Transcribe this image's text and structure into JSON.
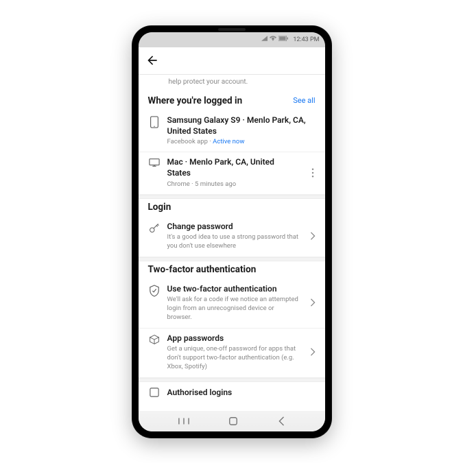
{
  "statusbar": {
    "time": "12:43 PM"
  },
  "helper_cut": "help protect your account.",
  "sections": {
    "logged_in": {
      "title": "Where you're logged in",
      "see_all": "See all",
      "s1": {
        "title": "Samsung Galaxy S9 · Menlo Park, CA, United States",
        "app": "Facebook app",
        "sep": " · ",
        "active": "Active now"
      },
      "s2": {
        "title": "Mac · Menlo Park, CA, United States",
        "sub": "Chrome · 5 minutes ago"
      }
    },
    "login": {
      "title": "Login",
      "change_pw": {
        "title": "Change password",
        "sub": "It's a good idea to use a strong password that you don't use elsewhere"
      }
    },
    "two_factor": {
      "title": "Two-factor authentication",
      "use_tfa": {
        "title": "Use two-factor authentication",
        "sub": "We'll ask for a code if we notice an attempted login from an unrecognised device or browser."
      },
      "app_pw": {
        "title": "App passwords",
        "sub": "Get a unique, one-off password for apps that don't support two-factor authentication (e.g. Xbox, Spotify)"
      },
      "auth_logins": {
        "title": "Authorised logins"
      }
    }
  }
}
